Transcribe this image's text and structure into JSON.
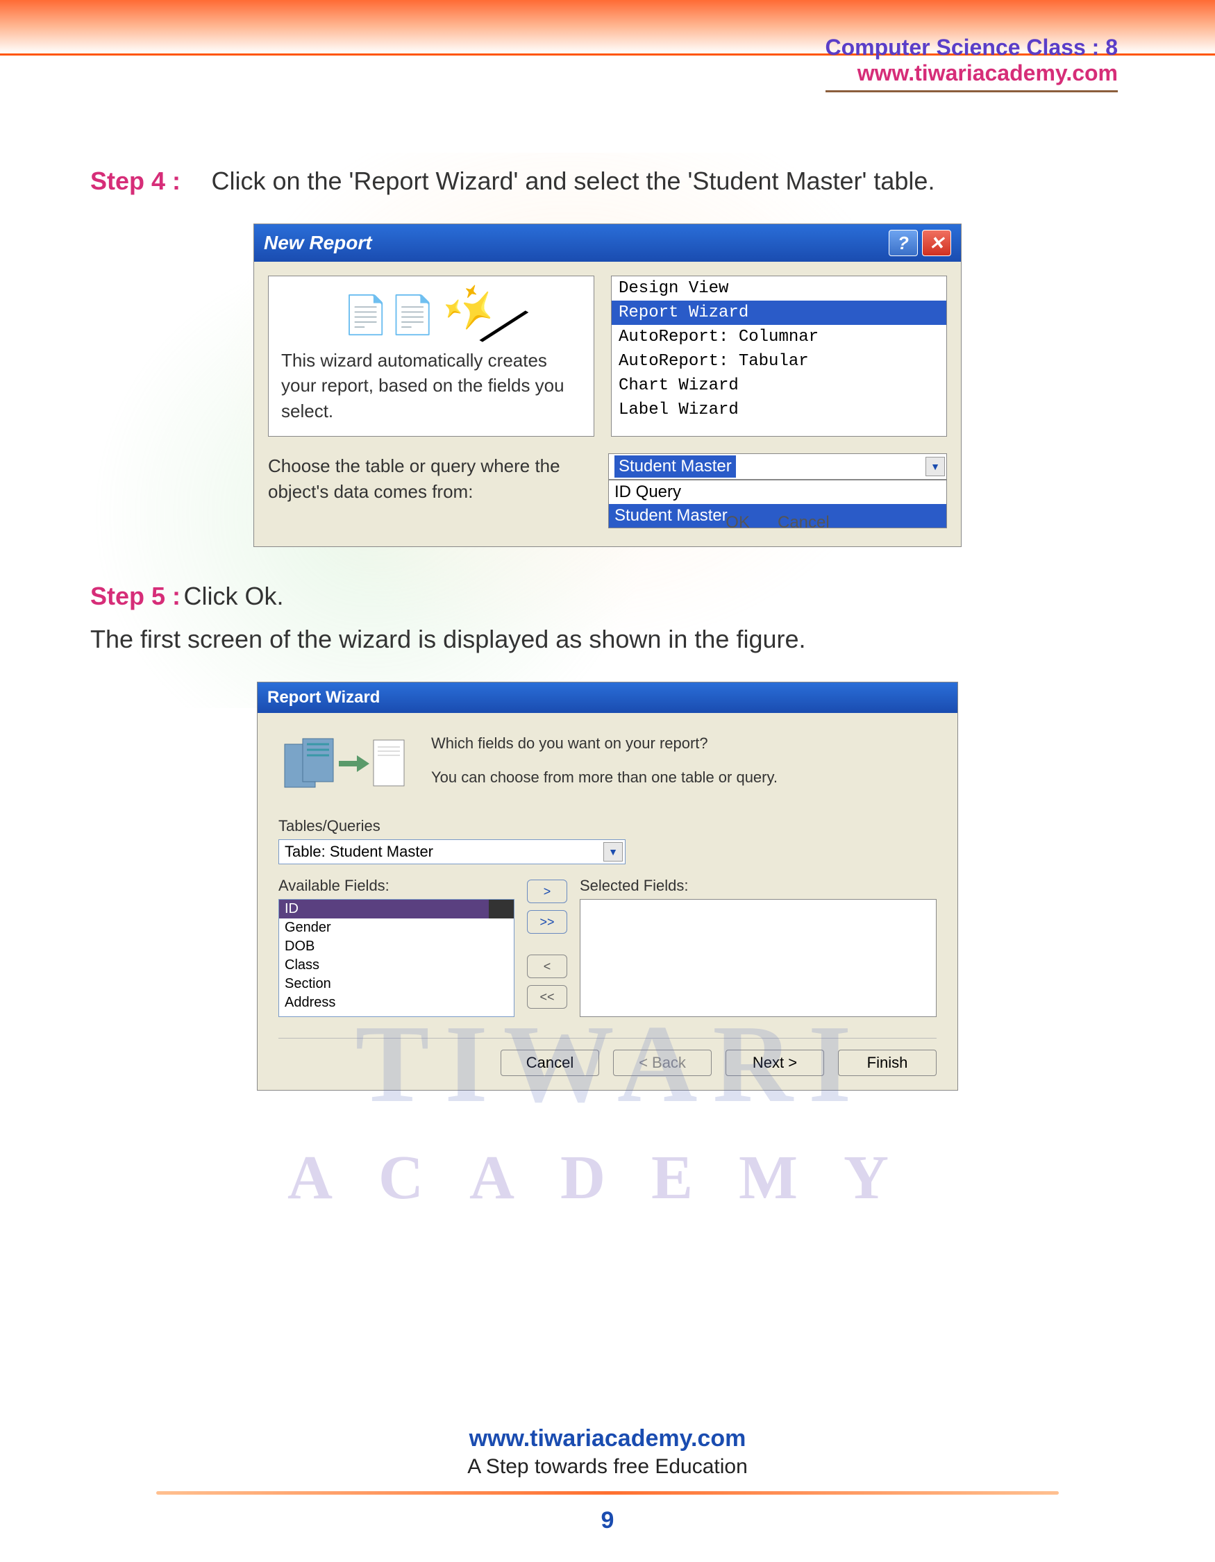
{
  "header": {
    "title": "Computer Science Class : 8",
    "url": "www.tiwariacademy.com"
  },
  "step4": {
    "label": "Step 4 :",
    "text": "Click on the 'Report Wizard' and select the 'Student Master' table."
  },
  "dialog1": {
    "title": "New Report",
    "description": "This wizard automatically creates your report, based on the fields you select.",
    "options": [
      "Design View",
      "Report Wizard",
      "AutoReport: Columnar",
      "AutoReport: Tabular",
      "Chart Wizard",
      "Label Wizard"
    ],
    "chooseLabel": "Choose the table or query where the object's data comes from:",
    "comboSelected": "Student Master",
    "dropdown": [
      "ID Query",
      "Student Master"
    ],
    "ok": "OK",
    "cancel": "Cancel"
  },
  "step5": {
    "label": "Step 5 :",
    "text": "  Click Ok.",
    "description": "The first screen of the wizard is displayed as shown in the figure."
  },
  "dialog2": {
    "title": "Report Wizard",
    "question1": "Which fields do you want on your report?",
    "question2": "You can choose from more than one table or query.",
    "tqLabel": "Tables/Queries",
    "tqValue": "Table: Student Master",
    "availLabel": "Available Fields:",
    "avail": [
      "ID",
      "Gender",
      "DOB",
      "Class",
      "Section",
      "Address"
    ],
    "selLabel": "Selected Fields:",
    "cancel": "Cancel",
    "back": "< Back",
    "next": "Next >",
    "finish": "Finish"
  },
  "watermark": {
    "line1": "TIWARI",
    "line2": "ACADEMY"
  },
  "footer": {
    "url": "www.tiwariacademy.com",
    "tag": "A Step towards free Education",
    "page": "9"
  }
}
